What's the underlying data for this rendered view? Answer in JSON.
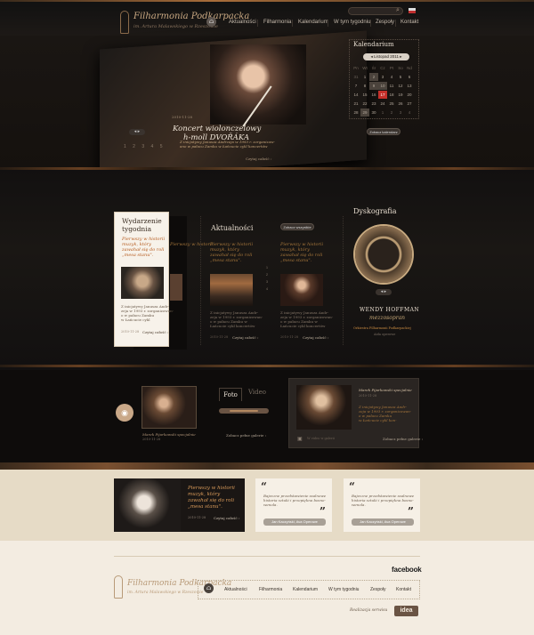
{
  "header": {
    "logo_title": "Filharmonia Podkarpacka",
    "logo_subtitle": "im. Artura Malawskiego w Rzeszowie",
    "home_icon": "home-icon",
    "search_icon": "search-icon",
    "nav": [
      "Aktualności",
      "Filharmonia",
      "Kalendarium",
      "W tym tygodniu",
      "Zespoły",
      "Kontakt"
    ]
  },
  "hero": {
    "date": "2010-11-28",
    "title_line1": "Koncert wiolonczelowy",
    "title_line2": "h-moll DVOŘÁKA",
    "desc_line1": "Z inicjatywy Janusza Andrzeja w 1993 r. zorganizow-",
    "desc_line2": "ano w pałacu Zamku w Łańcucie cykl koncertów",
    "read_more": "Czytaj całość",
    "pages": [
      "1",
      "2",
      "3",
      "4",
      "5"
    ]
  },
  "calendar": {
    "title": "Kalendarium",
    "month": "Listopad 2011",
    "dow": [
      "Pn",
      "Wt",
      "Śr",
      "Cz",
      "Pt",
      "So",
      "Nd"
    ],
    "weeks": [
      [
        "31",
        "1",
        "2",
        "3",
        "4",
        "5",
        "6"
      ],
      [
        "7",
        "8",
        "9",
        "10",
        "11",
        "12",
        "13"
      ],
      [
        "14",
        "15",
        "16",
        "17",
        "18",
        "19",
        "20"
      ],
      [
        "21",
        "22",
        "23",
        "24",
        "25",
        "26",
        "27"
      ],
      [
        "28",
        "29",
        "30",
        "1",
        "2",
        "3",
        "4"
      ]
    ],
    "button": "Zobacz kalendarz",
    "accent": "#c4302a"
  },
  "featured": {
    "title_line1": "Wydarzenie",
    "title_line2": "tygodnia",
    "text_line1": "Pierwszy w historii",
    "text_line2": "muzyk, który",
    "text_line3": "zawahał się do roli",
    "text_line4": "„mesa stanu\".",
    "desc_line1": "Z inicjatywy Janusza Andr-",
    "desc_line2": "zeja w 1993 r. zorganizowan-",
    "desc_line3": "o w pałacu Zamku",
    "desc_line4": "w Łańcucie cykl",
    "date": "2010-11-28",
    "read_more": "Czytaj całość"
  },
  "news": {
    "title": "Aktualności",
    "button": "Zobacz wszystkie",
    "items": [
      {
        "text_line1": "Pierwszy w historii",
        "text_line2": "muzyk, który",
        "text_line3": "zawahał się do roli",
        "text_line4": "„mesa stanu\".",
        "desc_line1": "Z inicjatywy Janusza Andr-",
        "desc_line2": "zeja w 1993 r. zorganizowan-",
        "desc_line3": "o w pałacu Zamku w",
        "desc_line4": "Łańcucie cykl koncertów",
        "date": "2010-11-28",
        "read_more": "Czytaj całość"
      },
      {
        "text_line1": "Pierwszy w historii",
        "text_line2": "muzyk, który",
        "text_line3": "zawahał się do roli",
        "text_line4": "„mesa stanu\".",
        "desc_line1": "Z inicjatywy Janusza Andr-",
        "desc_line2": "zeja w 1993 r. zorganizowan-",
        "desc_line3": "o w pałacu Zamku w",
        "desc_line4": "Łańcucie cykl koncertów",
        "date": "2010-11-28",
        "read_more": "Czytaj całość"
      }
    ],
    "pager": [
      "1",
      "2",
      "3",
      "4"
    ]
  },
  "discography": {
    "title": "Dyskografia",
    "name": "WENDY HOFFMAN",
    "role": "mezzosopran",
    "orchestra": "Orkiestra Filharmonii Podkarpackiej",
    "composer": "Aida operowe"
  },
  "media": {
    "camera_icon": "camera-icon",
    "caption": "Marek Pijarkowski specjalnie",
    "caption_date": "2010-11-28",
    "tab_photo": "Foto",
    "tab_video": "Video",
    "all_link": "Zobacz pełne galerie",
    "video_author": "Marek Pijarkowski specjalnie",
    "video_date": "2010-11-28",
    "video_text_line1": "Z inicjatywy Janusza Andr-",
    "video_text_line2": "zeja w 1993 r. zorganizowan-",
    "video_text_line3": "o w pałacu Zamku",
    "video_text_line4": "w Łańcucie cykl kon-",
    "video_hint": "W video w galerii",
    "video_link": "Zobacz pełne galerie"
  },
  "promo": {
    "text_line1": "Pierwszy w historii",
    "text_line2": "muzyk, który",
    "text_line3": "zawahał się do roli",
    "text_line4": "„mesa stanu\".",
    "date": "2010-11-28",
    "read_more": "Czytaj całość"
  },
  "quotes": [
    {
      "line1": "Bajeczne przedstawienie ssalnowe",
      "line2": "historia sztuki i przepiękna bosno-",
      "line3": "wenola.",
      "author": "Jan Kaczyński, Ava Operowe"
    },
    {
      "line1": "Bajeczne przedstawienie ssalnowe",
      "line2": "historia sztuki i przepiękna bosno-",
      "line3": "wenola.",
      "author": "Jan Kaczyński, Ava Operowe"
    }
  ],
  "footer": {
    "facebook": "facebook",
    "logo_title": "Filharmonia Podkarpacka",
    "logo_subtitle": "im. Artura Malawskiego w Rzeszowie",
    "nav": [
      "Aktualności",
      "Filharmonia",
      "Kalendarium",
      "W tym tygodniu",
      "Zespoły",
      "Kontakt"
    ],
    "credit": "Realizacja serwisu",
    "agency": "idea"
  }
}
